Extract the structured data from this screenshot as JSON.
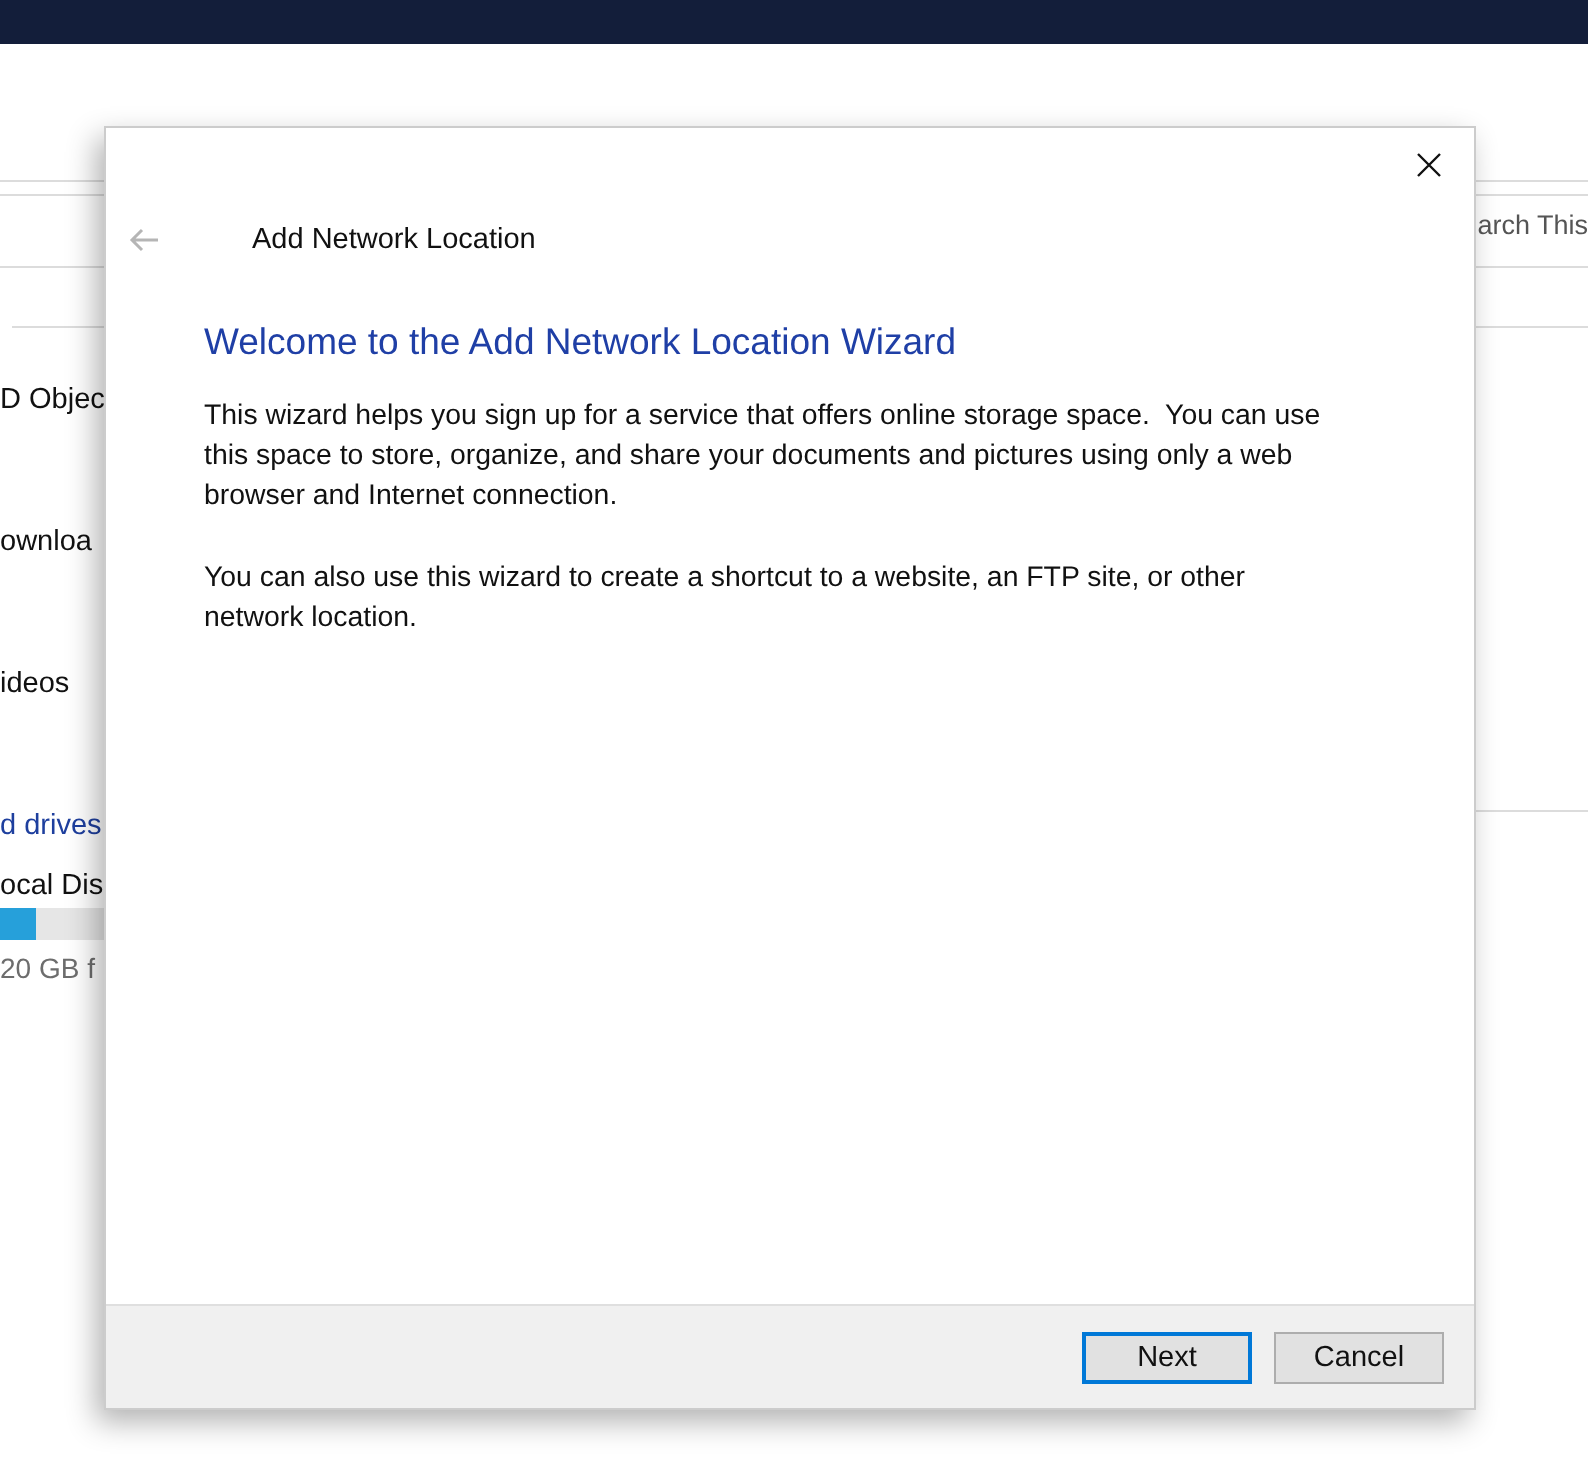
{
  "background_window": {
    "search_placeholder": "arch This",
    "nav_items": [
      {
        "label": "D Objec",
        "kind": "item"
      },
      {
        "label": "ownloa",
        "kind": "item"
      },
      {
        "label": "ideos",
        "kind": "item"
      },
      {
        "label": "d drives",
        "kind": "section"
      },
      {
        "label": "ocal Dis",
        "kind": "item"
      }
    ],
    "drive": {
      "level": 0.35,
      "free": "20 GB f"
    }
  },
  "dialog": {
    "title": "Add Network Location",
    "heading": "Welcome to the Add Network Location Wizard",
    "paragraphs": [
      "This wizard helps you sign up for a service that offers online storage space.  You can use this space to store, organize, and share your documents and pictures using only a web browser and Internet connection.",
      "You can also use this wizard to create a shortcut to a website, an FTP site, or other network location."
    ],
    "buttons": [
      {
        "label": "Next",
        "default": true
      },
      {
        "label": "Cancel",
        "default": false
      }
    ]
  }
}
